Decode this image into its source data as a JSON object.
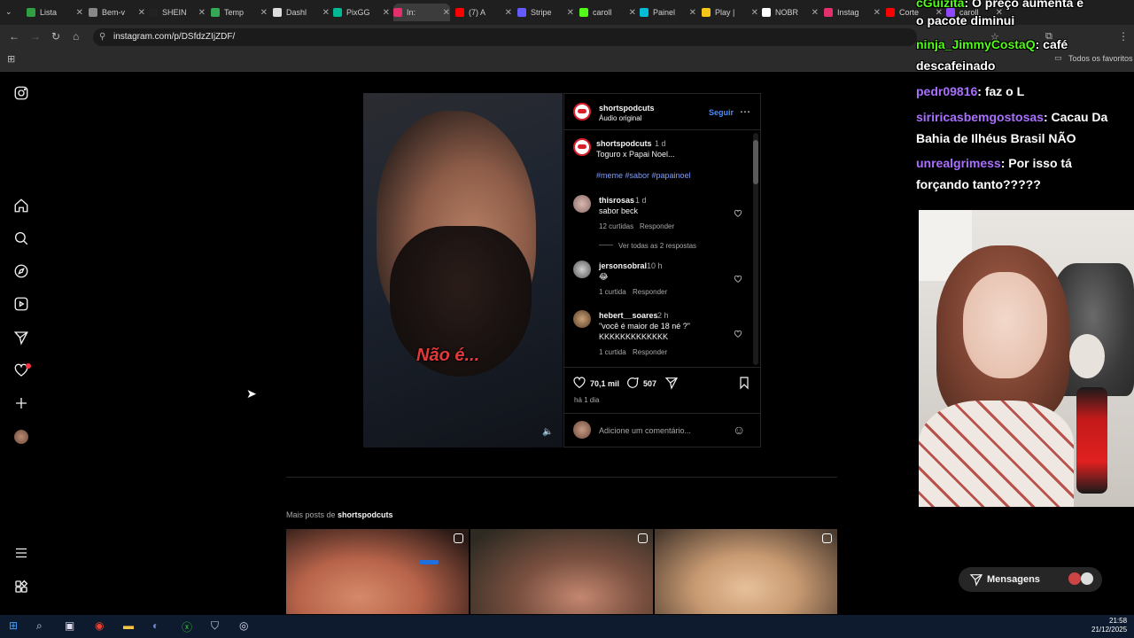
{
  "browser": {
    "tabs": [
      {
        "label": "Lista",
        "color": "#2ea043"
      },
      {
        "label": "Bem-v",
        "color": "#888888"
      },
      {
        "label": "SHEIN",
        "color": "#222222"
      },
      {
        "label": "Temp",
        "color": "#34a853"
      },
      {
        "label": "Dashl",
        "color": "#dddddd"
      },
      {
        "label": "PixGG",
        "color": "#00b894"
      },
      {
        "label": "In:",
        "color": "#e1306c"
      },
      {
        "label": "(7) A",
        "color": "#ff0000"
      },
      {
        "label": "Stripe",
        "color": "#635bff"
      },
      {
        "label": "caroll",
        "color": "#53fc18"
      },
      {
        "label": "Painel",
        "color": "#00bcd4"
      },
      {
        "label": "Play |",
        "color": "#f5c518"
      },
      {
        "label": "NOBR",
        "color": "#ffffff"
      },
      {
        "label": "Instag",
        "color": "#e1306c"
      },
      {
        "label": "Corte",
        "color": "#ff0000"
      },
      {
        "label": "caroll",
        "color": "#9146ff"
      }
    ],
    "url": "instagram.com/p/DSfdzZIjZDF/",
    "bookmarks_label": "Todos os favoritos"
  },
  "post": {
    "username": "shortspodcuts",
    "audio": "Áudio original",
    "follow": "Seguir",
    "caption_user": "shortspodcuts",
    "caption_time": "1 d",
    "caption_text": "Toguro x Papai Noel...",
    "hashtags": "#meme #sabor #papainoel",
    "video_subtitle": "Não é...",
    "likes": "70,1 mil",
    "comments_count": "507",
    "posted": "há 1 dia",
    "add_comment_placeholder": "Adicione um comentário..."
  },
  "comments": [
    {
      "user": "thisrosas",
      "time": "1 d",
      "text": "sabor beck",
      "likes": "12 curtidas",
      "reply": "Responder",
      "view_replies": "Ver todas as 2 respostas"
    },
    {
      "user": "jersonsobral",
      "time": "10 h",
      "text": "😂",
      "likes": "1 curtida",
      "reply": "Responder"
    },
    {
      "user": "hebert__soares",
      "time": "2 h",
      "text": "\"você é maior de 18 né ?\"",
      "text2": "KKKKKKKKKKKKK",
      "likes": "1 curtida",
      "reply": "Responder"
    }
  ],
  "more_posts": {
    "prefix": "Mais posts de ",
    "user": "shortspodcuts"
  },
  "messages_label": "Mensagens",
  "chat": [
    {
      "user": "cGuizita",
      "text": ": O preço aumenta e",
      "color": "#53fc18"
    },
    {
      "user": "",
      "text": "o pacote diminui",
      "color": "#ffffff"
    },
    {
      "user": "ninja_JimmyCostaQ",
      "text": ": café",
      "color": "#53fc18"
    },
    {
      "user": "",
      "text": "descafeinado",
      "color": "#ffffff"
    },
    {
      "user": "pedr09816",
      "text": ": faz o L",
      "color": "#a970ff"
    },
    {
      "user": "siriricasbemgostosas",
      "text": ": Cacau Da",
      "color": "#a970ff"
    },
    {
      "user": "",
      "text": "Bahia de Ilhéus Brasil NÃO",
      "color": "#ffffff"
    },
    {
      "user": "unrealgrimess",
      "text": ": Por isso tá",
      "color": "#a970ff"
    },
    {
      "user": "",
      "text": "forçando tanto?????",
      "color": "#ffffff"
    }
  ],
  "clock": {
    "time": "21:58",
    "date": "21/12/2025"
  }
}
